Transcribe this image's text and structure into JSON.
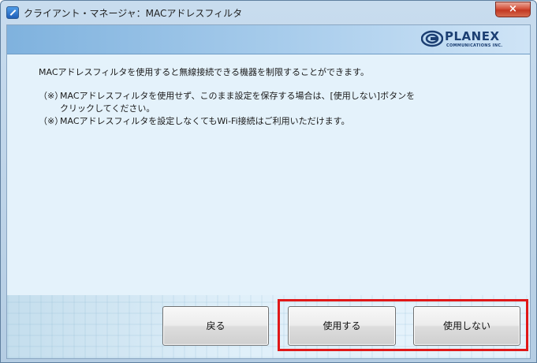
{
  "window": {
    "title": "クライアント・マネージャ：MACアドレスフィルタ",
    "close_label": "×"
  },
  "logo": {
    "name": "PLANEX",
    "sub": "COMMUNICATIONS INC."
  },
  "content": {
    "intro": "MACアドレスフィルタを使用すると無線接続できる機器を制限することができます。",
    "notes": [
      {
        "mark": "（※）",
        "line1": "MACアドレスフィルタを使用せず、このまま設定を保存する場合は、[使用しない]ボタンを",
        "line2": "クリックしてください。"
      },
      {
        "mark": "（※）",
        "line1": "MACアドレスフィルタを設定しなくてもWi-Fi接続はご利用いただけます。"
      }
    ]
  },
  "buttons": {
    "back": "戻る",
    "use": "使用する",
    "not_use": "使用しない"
  },
  "colors": {
    "highlight": "#e01818",
    "logo": "#1c3f73",
    "close": "#c23822"
  }
}
